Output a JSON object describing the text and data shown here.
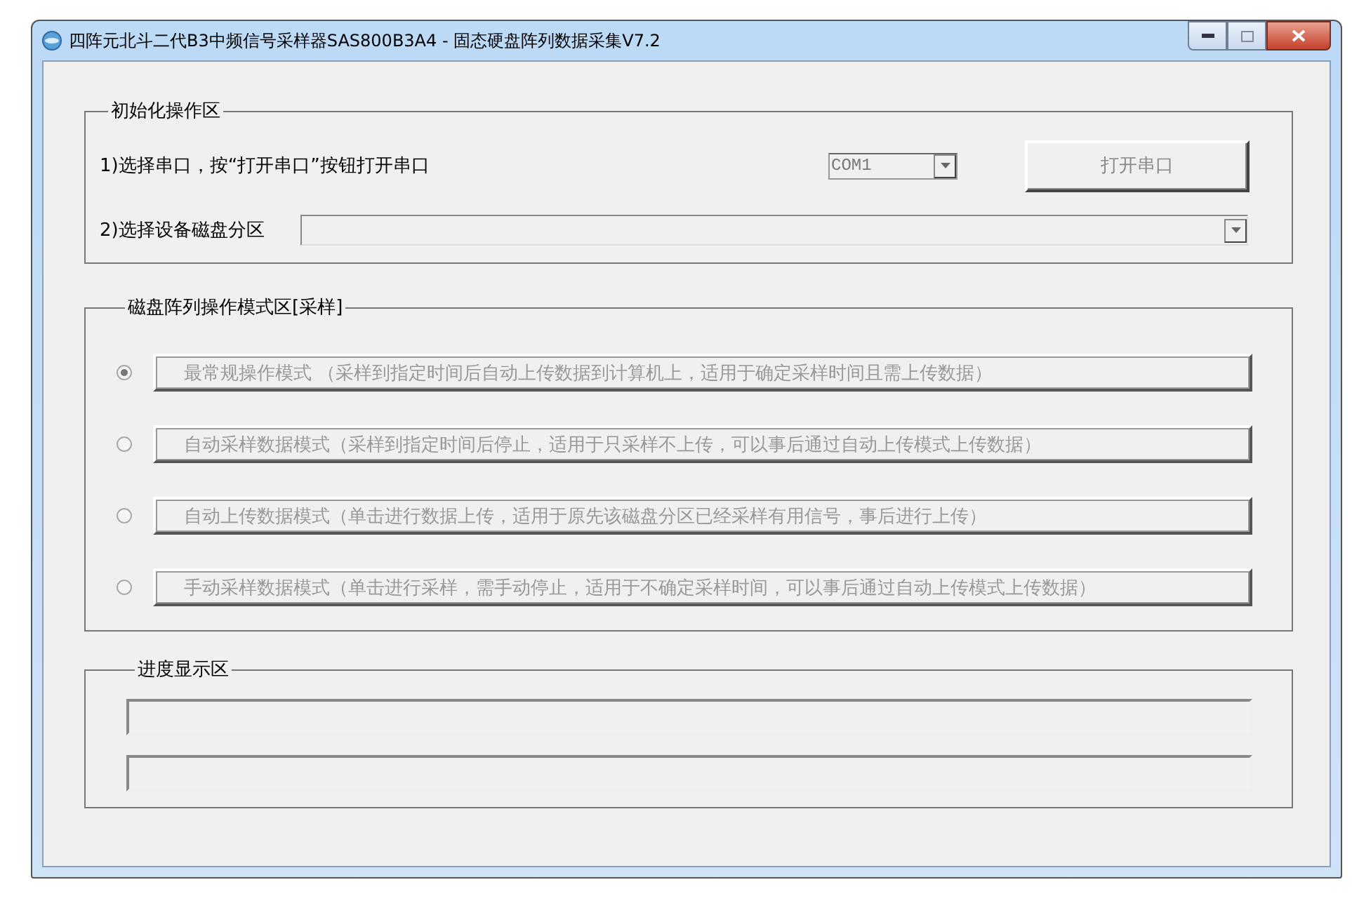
{
  "window": {
    "title": "四阵元北斗二代B3中频信号采样器SAS800B3A4 - 固态硬盘阵列数据采集V7.2"
  },
  "init_group": {
    "title": "初始化操作区",
    "step_1": {
      "label": "1)选择串口，按“打开串口”按钮打开串口",
      "port": {
        "value": "COM1",
        "disabled": true
      },
      "open_button": {
        "label": "打开串口",
        "disabled": true
      }
    },
    "step_2": {
      "label": "2)选择设备磁盘分区",
      "partition": {
        "disabled": true
      }
    }
  },
  "mode_group": {
    "title": "磁盘阵列操作模式区[采样]",
    "modes": [
      {
        "label": "最常规操作模式   （采样到指定时间后自动上传数据到计算机上，适用于确定采样时间且需上传数据）",
        "selected": true,
        "disabled": true
      },
      {
        "label": "自动采样数据模式（采样到指定时间后停止，适用于只采样不上传，可以事后通过自动上传模式上传数据）",
        "selected": false,
        "disabled": true
      },
      {
        "label": "自动上传数据模式（单击进行数据上传，适用于原先该磁盘分区已经采样有用信号，事后进行上传）",
        "selected": false,
        "disabled": true
      },
      {
        "label": "手动采样数据模式（单击进行采样，需手动停止，适用于不确定采样时间，可以事后通过自动上传模式上传数据）",
        "selected": false,
        "disabled": true
      }
    ]
  },
  "progress_group": {
    "title": "进度显示区",
    "bars": [
      {
        "level": 0
      },
      {
        "level": 0
      }
    ]
  }
}
